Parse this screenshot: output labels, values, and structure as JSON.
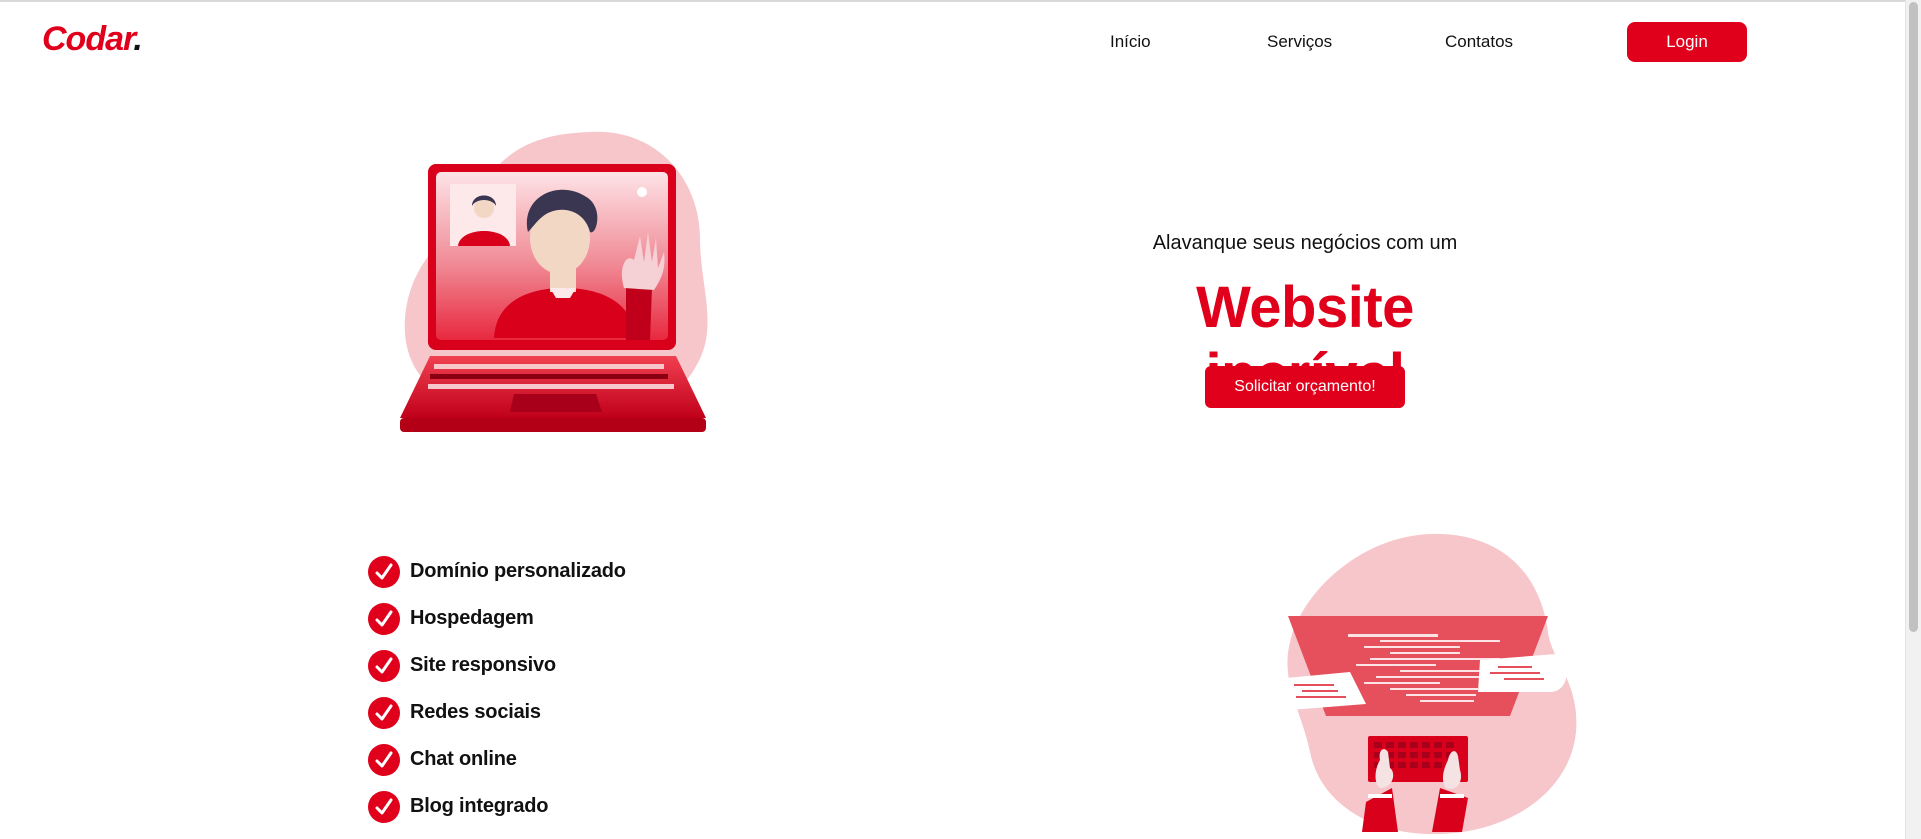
{
  "header": {
    "logo_text": "Codar",
    "logo_dot": ".",
    "nav": [
      "Início",
      "Serviços",
      "Contatos"
    ],
    "login_label": "Login"
  },
  "hero": {
    "subtitle": "Alavanque seus negócios com um",
    "title": "Website incrível",
    "cta_label": "Solicitar orçamento!"
  },
  "features": [
    "Domínio personalizado",
    "Hospedagem",
    "Site responsivo",
    "Redes sociais",
    "Chat online",
    "Blog integrado"
  ],
  "colors": {
    "accent": "#e0001b",
    "blob": "#f6c6ca"
  },
  "icons": [
    "laptop-videocall-illustration",
    "coding-keyboard-illustration",
    "check-icon"
  ]
}
